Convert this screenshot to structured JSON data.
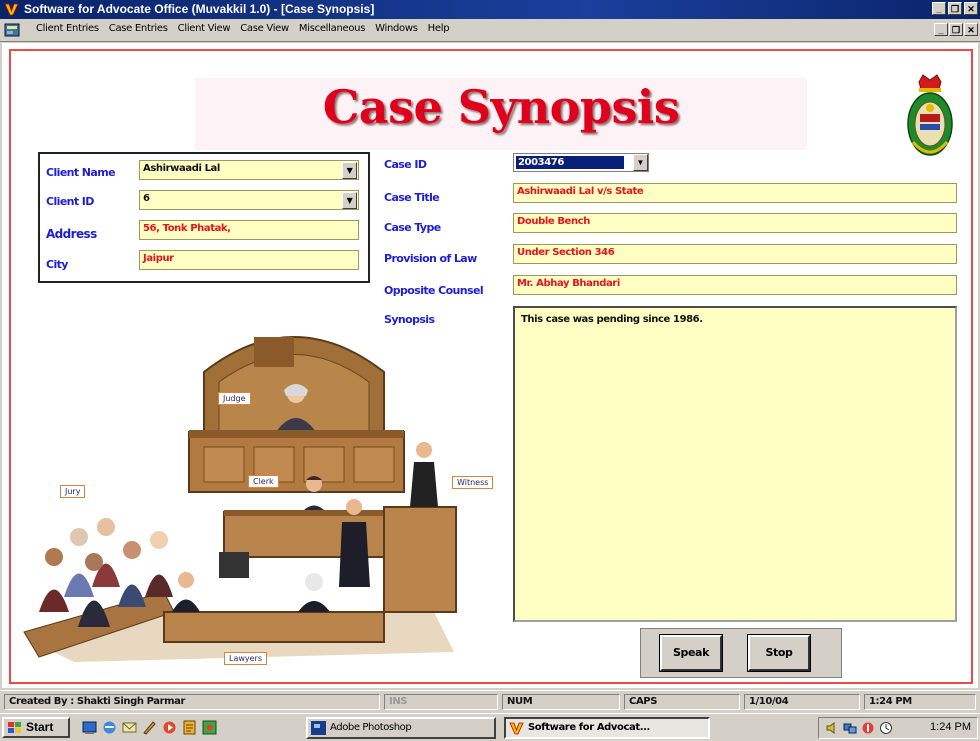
{
  "window": {
    "title": "Software for Advocate Office (Muvakkil 1.0) - [Case Synopsis]"
  },
  "menu": [
    "Client Entries",
    "Case Entries",
    "Client View",
    "Case View",
    "Miscellaneous",
    "Windows",
    "Help"
  ],
  "form": {
    "title": "Case Synopsis",
    "client": {
      "name_label": "Client Name",
      "name_value": "Ashirwaadi Lal",
      "id_label": "Client ID",
      "id_value": "6",
      "address_label": "Address",
      "address_value": "56, Tonk Phatak,",
      "city_label": "City",
      "city_value": "Jaipur"
    },
    "case": {
      "id_label": "Case ID",
      "id_value": "2003476",
      "title_label": "Case Title",
      "title_value": "Ashirwaadi Lal v/s State",
      "type_label": "Case Type",
      "type_value": "Double Bench",
      "law_label": "Provision of Law",
      "law_value": "Under Section 346",
      "counsel_label": "Opposite Counsel",
      "counsel_value": "Mr. Abhay Bhandari",
      "synopsis_label": "Synopsis",
      "synopsis_value": "This case was pending since 1986."
    },
    "court_tags": [
      "Judge",
      "Clerk",
      "Witness",
      "Jury",
      "Lawyers"
    ],
    "buttons": {
      "speak": "Speak",
      "stop": "Stop"
    }
  },
  "statusbar": {
    "created_by": "Created By : Shakti Singh Parmar",
    "ins": "INS",
    "num": "NUM",
    "caps": "CAPS",
    "date": "1/10/04",
    "time": "1:24 PM"
  },
  "taskbar": {
    "start": "Start",
    "tasks": [
      "Adobe Photoshop",
      "Software for Advocat..."
    ],
    "clock": "1:24 PM"
  }
}
